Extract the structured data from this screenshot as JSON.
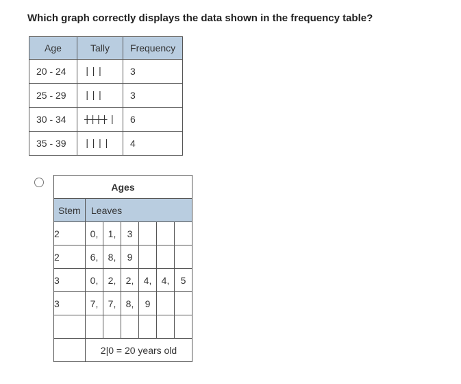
{
  "question": "Which graph correctly displays the data shown in the frequency table?",
  "freq_table": {
    "headers": {
      "age": "Age",
      "tally": "Tally",
      "frequency": "Frequency"
    },
    "rows": [
      {
        "age": "20 - 24",
        "tally": "|||",
        "tally5": "",
        "freq": "3"
      },
      {
        "age": "25 - 29",
        "tally": "|||",
        "tally5": "",
        "freq": "3"
      },
      {
        "age": "30 - 34",
        "tally": "|",
        "tally5": "||||",
        "freq": "6"
      },
      {
        "age": "35 - 39",
        "tally": "||||",
        "tally5": "",
        "freq": "4"
      }
    ]
  },
  "stem_leaf": {
    "title": "Ages",
    "headers": {
      "stem": "Stem",
      "leaves": "Leaves"
    },
    "rows": [
      {
        "stem": "2",
        "leaves": [
          "0,",
          "1,",
          "3",
          "",
          "",
          ""
        ]
      },
      {
        "stem": "2",
        "leaves": [
          "6,",
          "8,",
          "9",
          "",
          "",
          ""
        ]
      },
      {
        "stem": "3",
        "leaves": [
          "0,",
          "2,",
          "2,",
          "4,",
          "4,",
          "5"
        ]
      },
      {
        "stem": "3",
        "leaves": [
          "7,",
          "7,",
          "8,",
          "9",
          "",
          ""
        ]
      }
    ],
    "key": "2|0 = 20 years old"
  }
}
